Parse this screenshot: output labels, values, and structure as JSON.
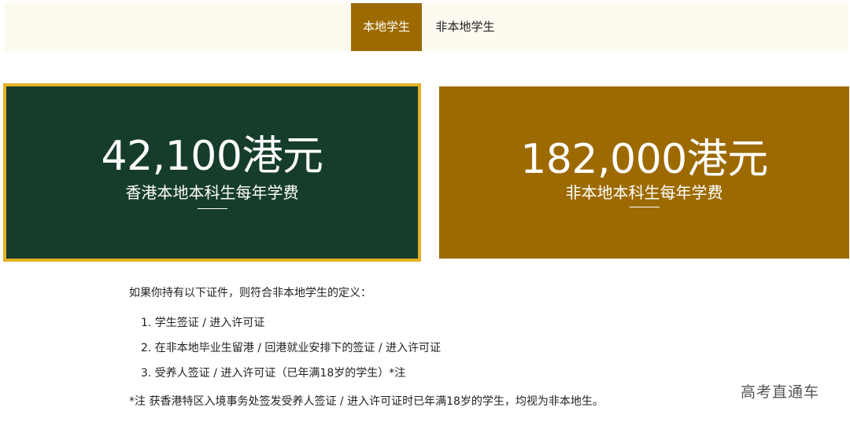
{
  "tabs": {
    "local": "本地学生",
    "nonlocal": "非本地学生"
  },
  "cards": {
    "local": {
      "amount": "42,100港元",
      "caption": "香港本地本科生每年学费"
    },
    "nonlocal": {
      "amount": "182,000港元",
      "caption": "非本地本科生每年学费"
    }
  },
  "notes": {
    "intro": "如果你持有以下证件，则符合非本地学生的定义：",
    "items": [
      "1. 学生签证 / 进入许可证",
      "2. 在非本地毕业生留港 / 回港就业安排下的签证 / 进入许可证",
      "3. 受养人签证 / 进入许可证（已年满18岁的学生）*注"
    ],
    "footnote": "*注 获香港特区入境事务处签发受养人签证 / 进入许可证时已年满18岁的学生，均视为非本地生。"
  },
  "watermark": "高考直通车",
  "colors": {
    "local_card": "#163d2b",
    "local_border": "#e5b124",
    "nonlocal_card": "#9c6a00",
    "active_tab": "#9c6a00",
    "tabbar_bg": "#fdfaf0"
  }
}
